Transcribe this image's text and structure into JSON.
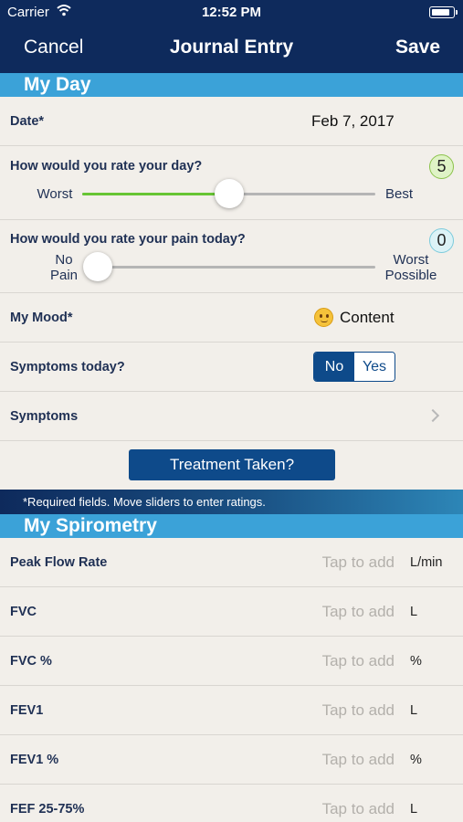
{
  "status_bar": {
    "carrier": "Carrier",
    "time": "12:52 PM"
  },
  "nav": {
    "cancel": "Cancel",
    "title": "Journal Entry",
    "save": "Save"
  },
  "my_day": {
    "header": "My Day",
    "date_label": "Date*",
    "date_value": "Feb 7, 2017",
    "day_rating": {
      "label": "How would you rate your day?",
      "value": "5",
      "min_label": "Worst",
      "max_label": "Best",
      "fraction": 0.5
    },
    "pain_rating": {
      "label": "How would you rate your pain today?",
      "value": "0",
      "min_label": "No\nPain",
      "max_label": "Worst\nPossible",
      "fraction": 0
    },
    "mood_label": "My Mood*",
    "mood_value": "Content",
    "symptoms_today_label": "Symptoms today?",
    "symptoms_toggle": {
      "no": "No",
      "yes": "Yes",
      "selected": "No"
    },
    "symptoms_label": "Symptoms",
    "treatment_button": "Treatment Taken?",
    "required_note": "*Required fields. Move sliders to enter ratings."
  },
  "my_spirometry": {
    "header": "My Spirometry",
    "placeholder": "Tap to add",
    "rows": [
      {
        "label": "Peak Flow Rate",
        "unit": "L/min"
      },
      {
        "label": "FVC",
        "unit": "L"
      },
      {
        "label": "FVC %",
        "unit": "%"
      },
      {
        "label": "FEV1",
        "unit": "L"
      },
      {
        "label": "FEV1 %",
        "unit": "%"
      },
      {
        "label": "FEF 25-75%",
        "unit": "L"
      }
    ]
  },
  "colors": {
    "nav_background": "#0e2a5c",
    "section_header": "#3ba2d8",
    "accent_button": "#0e4a8a",
    "slider_fill": "#67c534"
  },
  "icons": {
    "wifi": "wifi-icon",
    "battery": "battery-icon",
    "mood": "smiley-face-icon",
    "disclosure": "chevron-right-icon"
  }
}
